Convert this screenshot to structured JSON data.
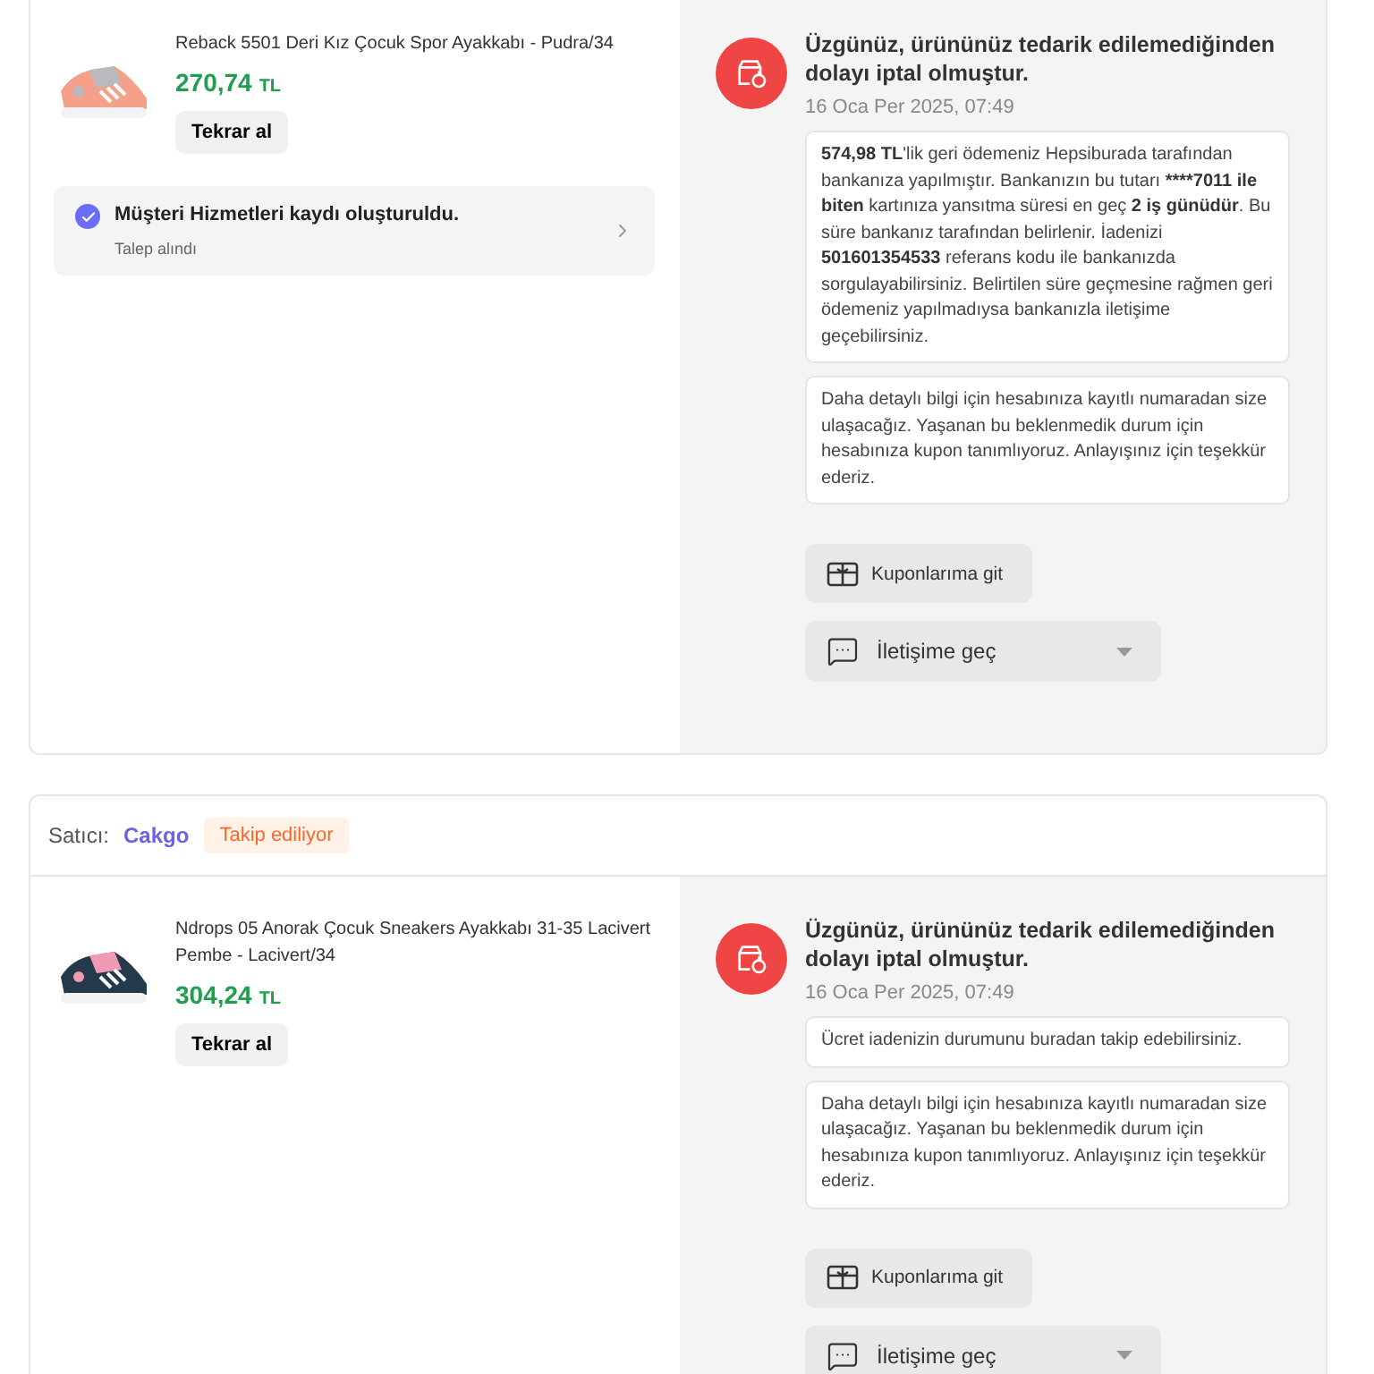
{
  "orders": [
    {
      "product": {
        "name": "Reback 5501 Deri Kız Çocuk Spor Ayakkabı - Pudra/34",
        "price": "270,74",
        "currency": "TL",
        "buy_again": "Tekrar al"
      },
      "status": {
        "title": "Müşteri Hizmetleri kaydı oluşturuldu.",
        "subtitle": "Talep alındı",
        "checked": true
      },
      "notice": {
        "title": "Üzgünüz, ürününüz tedarik edilemediğinden dolayı iptal olmuştur.",
        "date": "16 Oca Per 2025, 07:49",
        "messages": [
          [
            {
              "text": "574,98 TL",
              "bold": true
            },
            {
              "text": "'lik geri ödemeniz Hepsiburada tarafından bankanıza yapılmıştır. Bankanızın bu tutarı ",
              "bold": false
            },
            {
              "text": "****7011 ile biten",
              "bold": true
            },
            {
              "text": " kartınıza yansıtma süresi en geç ",
              "bold": false
            },
            {
              "text": "2 iş günüdür",
              "bold": true
            },
            {
              "text": ". Bu süre bankanız tarafından belirlenir. İadenizi ",
              "bold": false
            },
            {
              "text": "501601354533",
              "bold": true
            },
            {
              "text": " referans kodu ile bankanızda sorgulayabilirsiniz. Belirtilen süre geçmesine rağmen geri ödemeniz yapılmadıysa bankanızla iletişime geçebilirsiniz.",
              "bold": false
            }
          ],
          "Daha detaylı bilgi için hesabınıza kayıtlı numaradan size ulaşacağız. Yaşanan bu beklenmedik durum için hesabınıza kupon tanımlıyoruz. Anlayışınız için teşekkür ederiz."
        ],
        "coupon_button": "Kuponlarıma git",
        "contact_button": "İletişime geç"
      }
    },
    {
      "seller": {
        "label": "Satıcı:",
        "name": "Cakgo",
        "badge": "Takip ediliyor"
      },
      "product": {
        "name": "Ndrops 05 Anorak Çocuk Sneakers Ayakkabı 31-35 Lacivert Pembe - Lacivert/34",
        "price": "304,24",
        "currency": "TL",
        "buy_again": "Tekrar al"
      },
      "notice": {
        "title": "Üzgünüz, ürününüz tedarik edilemediğinden dolayı iptal olmuştur.",
        "date": "16 Oca Per 2025, 07:49",
        "messages": [
          "Ücret iadenizin durumunu buradan takip edebilirsiniz.",
          "Daha detaylı bilgi için hesabınıza kayıtlı numaradan size ulaşacağız. Yaşanan bu beklenmedik durum için hesabınıza kupon tanımlıyoruz. Anlayışınız için teşekkür ederiz."
        ],
        "coupon_button": "Kuponlarıma git",
        "contact_button": "İletişime geç"
      }
    }
  ]
}
